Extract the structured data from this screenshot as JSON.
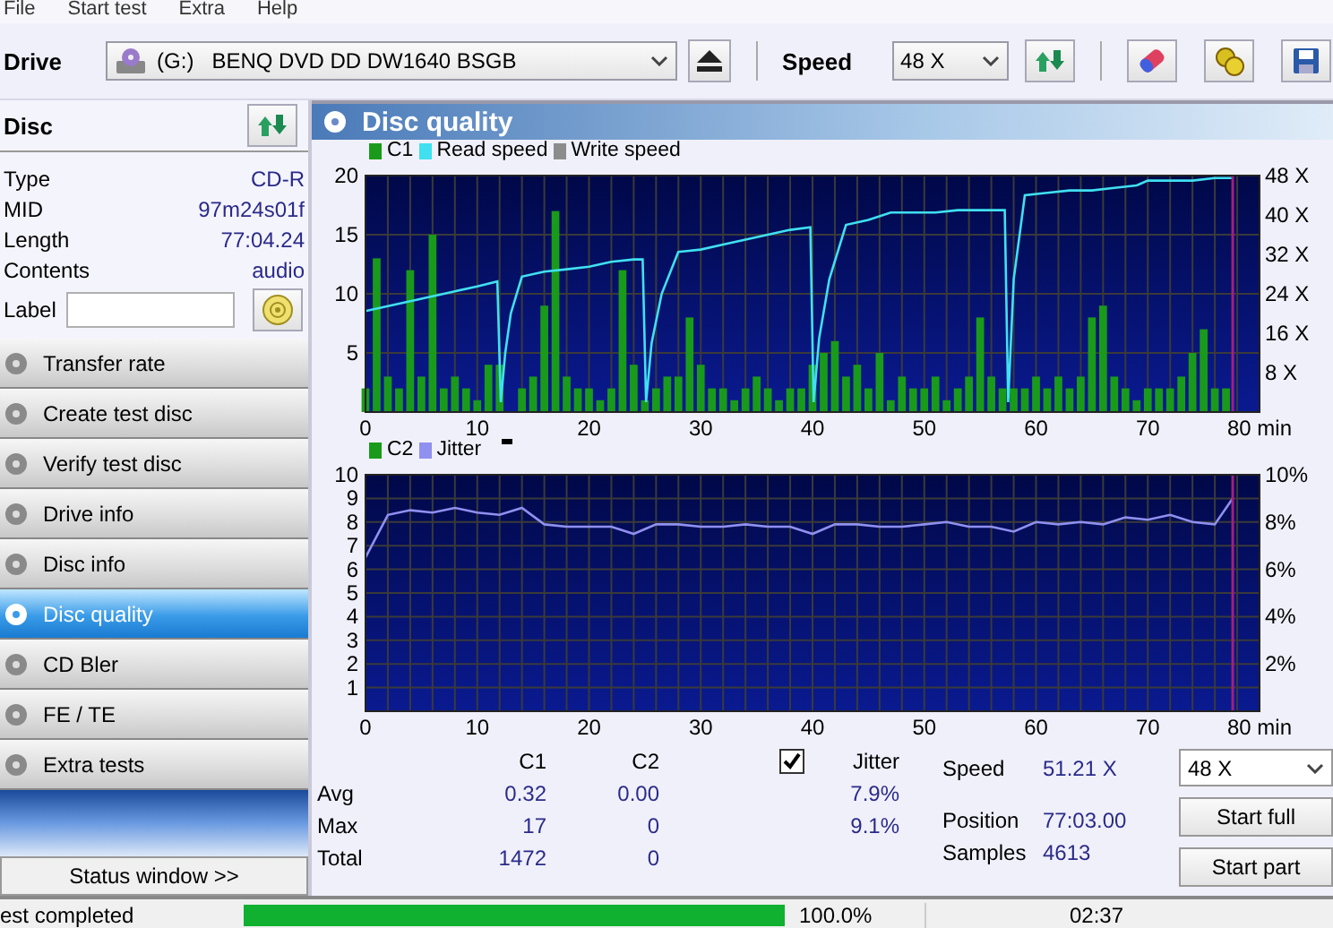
{
  "menu": [
    "File",
    "Start test",
    "Extra",
    "Help"
  ],
  "toolbar": {
    "drive_label": "Drive",
    "drive": "(G:)   BENQ DVD DD DW1640 BSGB",
    "speed_label": "Speed",
    "speed": "48 X"
  },
  "disc": {
    "title": "Disc",
    "fields": [
      {
        "label": "Type",
        "value": "CD-R"
      },
      {
        "label": "MID",
        "value": "97m24s01f"
      },
      {
        "label": "Length",
        "value": "77:04.24"
      },
      {
        "label": "Contents",
        "value": "audio"
      }
    ],
    "label_caption": "Label"
  },
  "nav": [
    {
      "label": "Transfer rate",
      "selected": false
    },
    {
      "label": "Create test disc",
      "selected": false
    },
    {
      "label": "Verify test disc",
      "selected": false
    },
    {
      "label": "Drive info",
      "selected": false
    },
    {
      "label": "Disc info",
      "selected": false
    },
    {
      "label": "Disc quality",
      "selected": true
    },
    {
      "label": "CD Bler",
      "selected": false
    },
    {
      "label": "FE / TE",
      "selected": false
    },
    {
      "label": "Extra tests",
      "selected": false
    }
  ],
  "status_window_button": "Status window >>",
  "panel_title": "Disc quality",
  "c1_chart": {
    "chart_data": {
      "type": "bar",
      "legend": "top",
      "grid": true,
      "ref_lines": [
        {
          "axis": "x",
          "value": 77.6,
          "color": "#a02080"
        }
      ],
      "xlim": [
        0,
        80
      ],
      "ylim": [
        0,
        20
      ],
      "y2lim": [
        0,
        48
      ],
      "xticks": [
        0,
        10,
        20,
        30,
        40,
        50,
        60,
        70,
        {
          "value": 80,
          "label": "80 min"
        }
      ],
      "yticks": [
        5,
        10,
        15,
        20
      ],
      "y2ticks": [
        {
          "value": 8,
          "label": "8 X"
        },
        {
          "value": 16,
          "label": "16 X"
        },
        {
          "value": 24,
          "label": "24 X"
        },
        {
          "value": 32,
          "label": "32 X"
        },
        {
          "value": 40,
          "label": "40 X"
        },
        {
          "value": 48,
          "label": "48 X"
        }
      ],
      "series": [
        {
          "name": "C1",
          "color": "#1a9a1a",
          "x": [
            0,
            1,
            2,
            3,
            4,
            5,
            6,
            7,
            8,
            9,
            10,
            11,
            12,
            13,
            14,
            15,
            16,
            17,
            18,
            19,
            20,
            21,
            22,
            23,
            24,
            25,
            26,
            27,
            28,
            29,
            30,
            31,
            32,
            33,
            34,
            35,
            36,
            37,
            38,
            39,
            40,
            41,
            42,
            43,
            44,
            45,
            46,
            47,
            48,
            49,
            50,
            51,
            52,
            53,
            54,
            55,
            56,
            57,
            58,
            59,
            60,
            61,
            62,
            63,
            64,
            65,
            66,
            67,
            68,
            69,
            70,
            71,
            72,
            73,
            74,
            75,
            76,
            77
          ],
          "values": [
            2,
            13,
            3,
            2,
            12,
            3,
            15,
            2,
            3,
            2,
            1,
            4,
            4,
            0,
            2,
            3,
            9,
            17,
            3,
            2,
            2,
            1,
            2,
            12,
            4,
            1,
            2,
            3,
            3,
            8,
            4,
            2,
            2,
            1,
            2,
            3,
            2,
            1,
            2,
            2,
            4,
            5,
            6,
            3,
            4,
            2,
            5,
            1,
            3,
            2,
            2,
            3,
            1,
            2,
            3,
            8,
            3,
            2,
            2,
            2,
            3,
            2,
            3,
            2,
            3,
            8,
            9,
            3,
            2,
            1,
            2,
            2,
            2,
            3,
            5,
            7,
            2,
            2
          ]
        },
        {
          "name": "Read speed",
          "color": "#40e0f0",
          "type": "line",
          "axis": "y2",
          "x": [
            0,
            2,
            4,
            6,
            8,
            10,
            11.8,
            12.1,
            12.5,
            13,
            14,
            16,
            18,
            20,
            22,
            24,
            24.8,
            25.1,
            25.6,
            26.5,
            28,
            30,
            32,
            34,
            36,
            38,
            39.8,
            40.1,
            40.6,
            41.5,
            43,
            45,
            47,
            49,
            51,
            53,
            55,
            57.2,
            57.5,
            58,
            59,
            61,
            63,
            65,
            67,
            69,
            70,
            72,
            74,
            76,
            77.6
          ],
          "values": [
            20.5,
            21.5,
            22.5,
            23.5,
            24.5,
            25.5,
            26.5,
            2,
            12,
            20,
            27.5,
            28.5,
            29,
            29.5,
            30.5,
            31,
            31,
            2,
            14,
            24,
            32.5,
            33,
            34,
            35,
            36,
            37,
            37.5,
            2,
            15,
            27,
            38,
            39,
            40.5,
            40.5,
            40.5,
            41,
            41,
            41,
            2,
            27,
            44,
            44.5,
            45,
            45,
            45.5,
            46,
            47,
            47,
            47,
            47.5,
            47.5
          ]
        },
        {
          "name": "Write speed",
          "color": "#8c8c8c"
        }
      ]
    }
  },
  "jitter_chart": {
    "chart_data": {
      "type": "line",
      "legend": "top",
      "grid": true,
      "ref_lines": [
        {
          "axis": "x",
          "value": 77.6,
          "color": "#a02080"
        }
      ],
      "xlim": [
        0,
        80
      ],
      "ylim": [
        0,
        10
      ],
      "y2lim": [
        0,
        10
      ],
      "xticks": [
        0,
        10,
        20,
        30,
        40,
        50,
        60,
        70,
        {
          "value": 80,
          "label": "80 min"
        }
      ],
      "yticks": [
        1,
        2,
        3,
        4,
        5,
        6,
        7,
        8,
        9,
        10
      ],
      "y2ticks": [
        {
          "value": 2,
          "label": "2%"
        },
        {
          "value": 4,
          "label": "4%"
        },
        {
          "value": 6,
          "label": "6%"
        },
        {
          "value": 8,
          "label": "8%"
        },
        {
          "value": 10,
          "label": "10%"
        }
      ],
      "series": [
        {
          "name": "C2",
          "color": "#1a9a1a"
        },
        {
          "name": "Jitter",
          "color": "#9090f0",
          "x": [
            0,
            2,
            4,
            6,
            8,
            10,
            12,
            14,
            16,
            18,
            20,
            22,
            24,
            26,
            28,
            30,
            32,
            34,
            36,
            38,
            40,
            42,
            44,
            46,
            48,
            50,
            52,
            54,
            56,
            58,
            60,
            62,
            64,
            66,
            68,
            70,
            72,
            74,
            76,
            77.6
          ],
          "values": [
            6.5,
            8.3,
            8.5,
            8.4,
            8.6,
            8.4,
            8.3,
            8.6,
            7.9,
            7.8,
            7.8,
            7.8,
            7.5,
            7.9,
            7.9,
            7.8,
            7.8,
            7.9,
            7.8,
            7.8,
            7.5,
            7.9,
            7.9,
            7.8,
            7.8,
            7.9,
            8.0,
            7.8,
            7.8,
            7.6,
            8.0,
            7.9,
            8.0,
            7.9,
            8.2,
            8.1,
            8.3,
            8.0,
            7.9,
            9.0
          ]
        }
      ]
    }
  },
  "stats": {
    "columns": [
      "C1",
      "C2"
    ],
    "rows": [
      {
        "label": "Avg",
        "c1": "0.32",
        "c2": "0.00",
        "jitter": "7.9%"
      },
      {
        "label": "Max",
        "c1": "17",
        "c2": "0",
        "jitter": "9.1%"
      },
      {
        "label": "Total",
        "c1": "1472",
        "c2": "0"
      }
    ],
    "jitter": {
      "label": "Jitter",
      "checked": true
    },
    "info": [
      {
        "label": "Speed",
        "value": "51.21 X"
      },
      {
        "label": "Position",
        "value": "77:03.00"
      },
      {
        "label": "Samples",
        "value": "4613"
      }
    ],
    "speed_select": "48 X",
    "buttons": [
      "Start full",
      "Start part"
    ]
  },
  "status_bar": {
    "message": "est completed",
    "progress": {
      "level": 1.0
    },
    "percent": "100.0%",
    "time": "02:37"
  }
}
